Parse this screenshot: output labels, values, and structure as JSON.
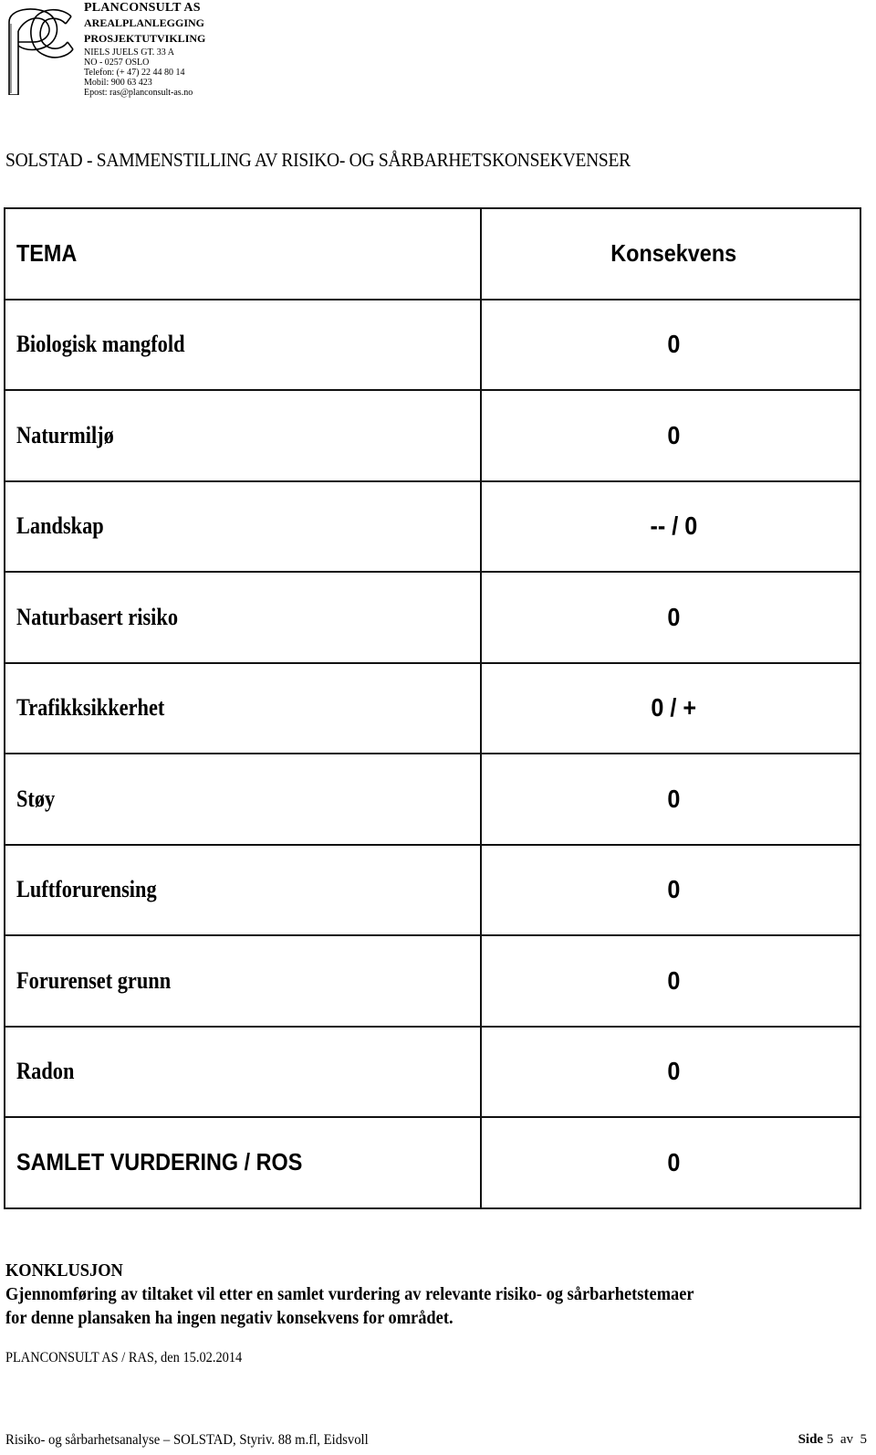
{
  "letterhead": {
    "logo_icon": "pc-monogram-logo",
    "company": "PLANCONSULT  AS",
    "service_1": "AREALPLANLEGGING",
    "service_2": "PROSJEKTUTVIKLING",
    "address": "NIELS JUELS GT. 33 A",
    "postal": "NO - 0257 OSLO",
    "phone": "Telefon: (+ 47) 22 44 80 14",
    "mobile": "Mobil:  900 63 423",
    "email": "Epost: ras@planconsult-as.no"
  },
  "title": "SOLSTAD - SAMMENSTILLING AV RISIKO- OG SÅRBARHETSKONSEKVENSER",
  "table": {
    "headers": {
      "tema": "TEMA",
      "konsekvens": "Konsekvens"
    },
    "rows": [
      {
        "tema": "Biologisk mangfold",
        "konsekvens": "0"
      },
      {
        "tema": "Naturmiljø",
        "konsekvens": "0"
      },
      {
        "tema": "Landskap",
        "konsekvens": "-- / 0"
      },
      {
        "tema": "Naturbasert risiko",
        "konsekvens": "0"
      },
      {
        "tema": "Trafikksikkerhet",
        "konsekvens": "0 / +"
      },
      {
        "tema": "Støy",
        "konsekvens": "0"
      },
      {
        "tema": "Luftforurensing",
        "konsekvens": "0"
      },
      {
        "tema": "Forurenset grunn",
        "konsekvens": "0"
      },
      {
        "tema": "Radon",
        "konsekvens": "0"
      },
      {
        "tema": "SAMLET VURDERING / ROS",
        "konsekvens": "0"
      }
    ]
  },
  "conclusion": {
    "heading": "KONKLUSJON",
    "line_1": "Gjennomføring av tiltaket vil etter en samlet vurdering av relevante risiko- og sårbarhetstemaer",
    "line_2": "for denne plansaken ha ingen negativ konsekvens for området."
  },
  "signature": "PLANCONSULT AS  /  RAS, den 15.02.2014",
  "footer": {
    "document": "Risiko- og sårbarhetsanalyse – SOLSTAD, Styriv. 88 m.fl, Eidsvoll",
    "page_label": "Side",
    "page_current": "5",
    "page_of": "av",
    "page_total": "5"
  }
}
